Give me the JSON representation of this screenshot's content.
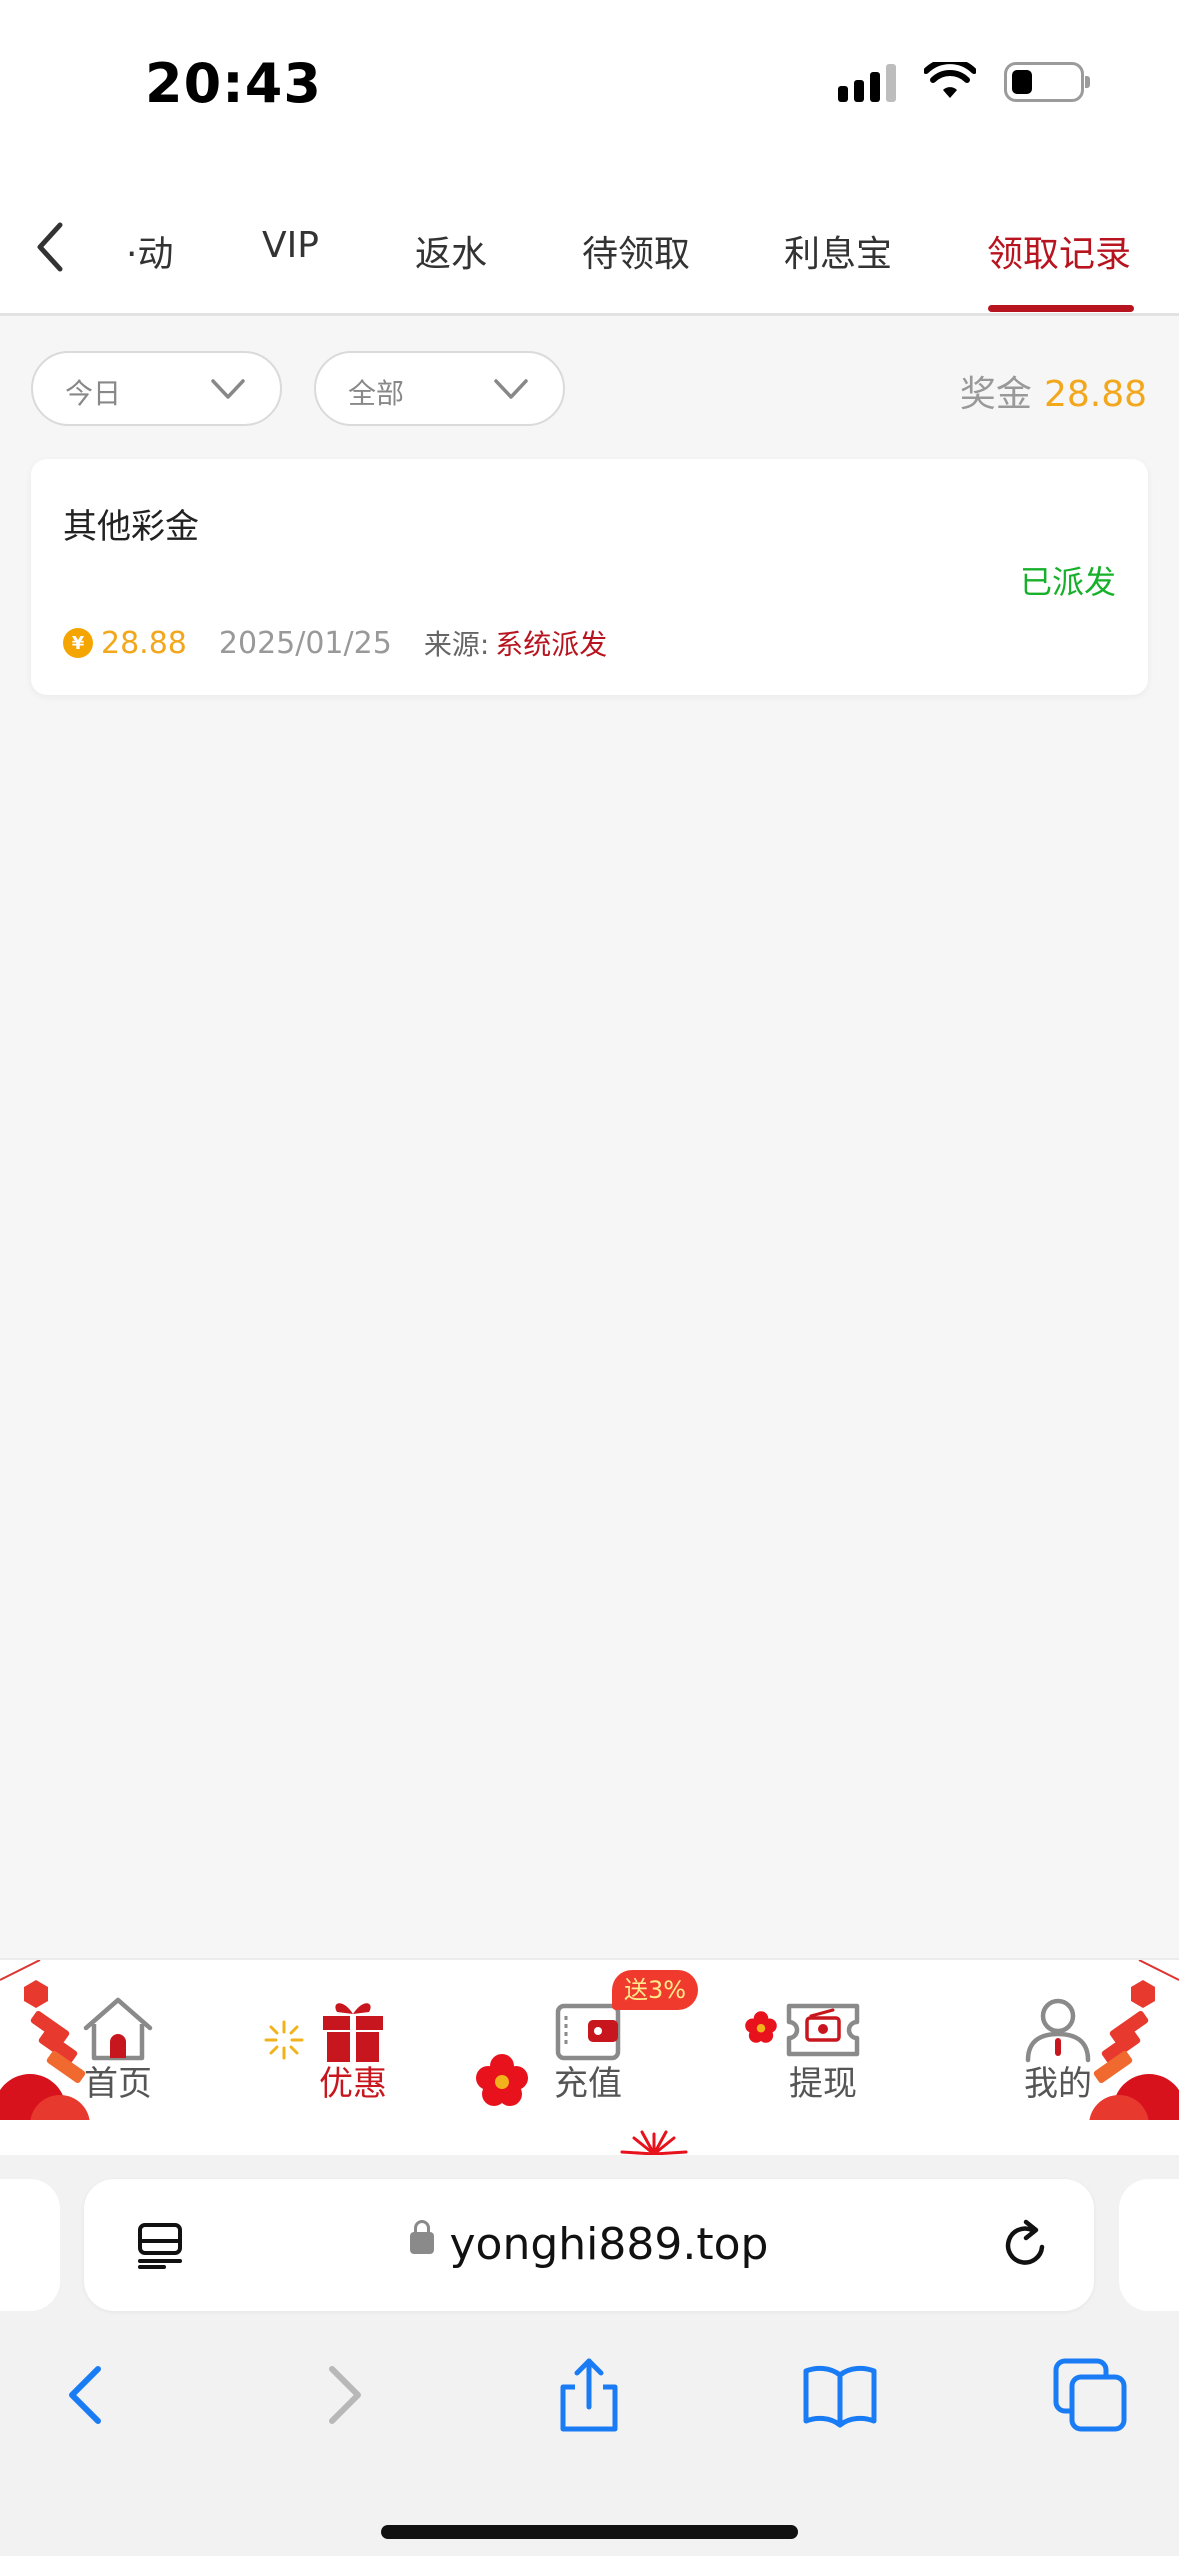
{
  "status_bar": {
    "time": "20:43"
  },
  "tabs": [
    {
      "label": "·动"
    },
    {
      "label": "VIP"
    },
    {
      "label": "返水"
    },
    {
      "label": "待领取"
    },
    {
      "label": "利息宝"
    },
    {
      "label": "领取记录"
    }
  ],
  "active_tab": "领取记录",
  "filters": {
    "date": "今日",
    "type": "全部"
  },
  "bonus": {
    "label": "奖金",
    "value": "28.88"
  },
  "records": [
    {
      "title": "其他彩金",
      "status": "已派发",
      "amount": "28.88",
      "date": "2025/01/25",
      "source_label": "来源:",
      "source": "系统派发"
    }
  ],
  "bottom_nav": {
    "items": [
      {
        "label": "首页",
        "icon": "home-icon"
      },
      {
        "label": "优惠",
        "icon": "gift-icon"
      },
      {
        "label": "充值",
        "icon": "wallet-icon"
      },
      {
        "label": "提现",
        "icon": "withdraw-ticket-icon"
      },
      {
        "label": "我的",
        "icon": "user-icon"
      }
    ],
    "active": "优惠",
    "promo_badge": "送3%"
  },
  "browser": {
    "url": "yonghi889.top"
  },
  "colors": {
    "accent": "#b8141f",
    "gold": "#f2a71c",
    "success": "#17b02b"
  }
}
